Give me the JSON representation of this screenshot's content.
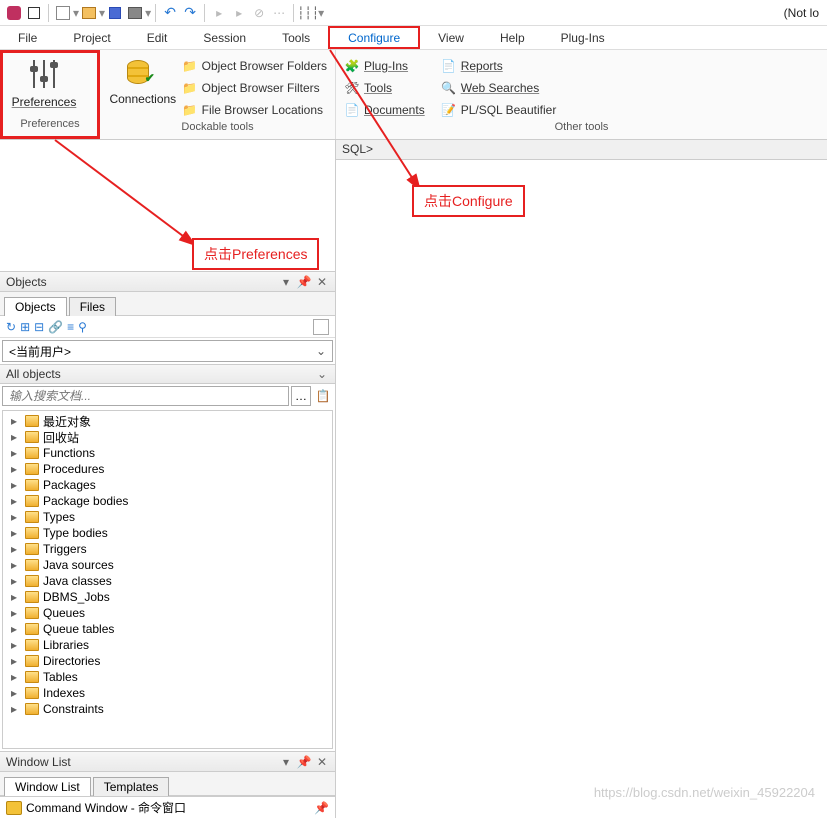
{
  "top_status": "(Not lo",
  "menus": [
    "File",
    "Project",
    "Edit",
    "Session",
    "Tools",
    "Configure",
    "View",
    "Help",
    "Plug-Ins"
  ],
  "ribbon": {
    "preferences": {
      "button": "Preferences",
      "group": "Preferences"
    },
    "dockable": {
      "connections": "Connections",
      "items": [
        "Object Browser Folders",
        "Object Browser Filters",
        "File Browser Locations"
      ],
      "group": "Dockable tools"
    },
    "other": {
      "col1": [
        "Plug-Ins",
        "Tools",
        "Documents"
      ],
      "col2": [
        "Reports",
        "Web Searches",
        "PL/SQL Beautifier"
      ],
      "group": "Other tools"
    }
  },
  "sql_prompt": "SQL>",
  "annotations": {
    "configure": "点击Configure",
    "preferences": "点击Preferences"
  },
  "objects": {
    "title": "Objects",
    "tabs": [
      "Objects",
      "Files"
    ],
    "user_combo": "<当前用户>",
    "all_objects": "All objects",
    "search_placeholder": "输入搜索文档...",
    "tree": [
      "最近对象",
      "回收站",
      "Functions",
      "Procedures",
      "Packages",
      "Package bodies",
      "Types",
      "Type bodies",
      "Triggers",
      "Java sources",
      "Java classes",
      "DBMS_Jobs",
      "Queues",
      "Queue tables",
      "Libraries",
      "Directories",
      "Tables",
      "Indexes",
      "Constraints"
    ]
  },
  "windowlist": {
    "title": "Window List",
    "tabs": [
      "Window List",
      "Templates"
    ],
    "item": "Command Window - 命令窗口"
  },
  "watermark": "https://blog.csdn.net/weixin_45922204"
}
